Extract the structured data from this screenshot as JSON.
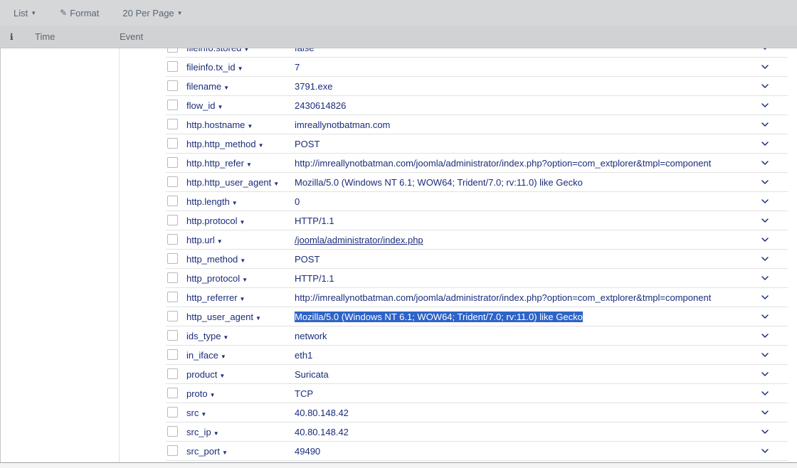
{
  "toolbar": {
    "list_label": "List",
    "format_label": "Format",
    "per_page_label": "20 Per Page"
  },
  "header": {
    "info_icon": "i",
    "time_label": "Time",
    "event_label": "Event"
  },
  "fields": [
    {
      "name": "fileinfo.stored",
      "value": "false",
      "style": "normal"
    },
    {
      "name": "fileinfo.tx_id",
      "value": "7",
      "style": "normal"
    },
    {
      "name": "filename",
      "value": "3791.exe",
      "style": "normal"
    },
    {
      "name": "flow_id",
      "value": "2430614826",
      "style": "normal"
    },
    {
      "name": "http.hostname",
      "value": "imreallynotbatman.com",
      "style": "normal"
    },
    {
      "name": "http.http_method",
      "value": "POST",
      "style": "normal"
    },
    {
      "name": "http.http_refer",
      "value": "http://imreallynotbatman.com/joomla/administrator/index.php?option=com_extplorer&tmpl=component",
      "style": "normal"
    },
    {
      "name": "http.http_user_agent",
      "value": "Mozilla/5.0 (Windows NT 6.1; WOW64; Trident/7.0; rv:11.0) like Gecko",
      "style": "normal"
    },
    {
      "name": "http.length",
      "value": "0",
      "style": "normal"
    },
    {
      "name": "http.protocol",
      "value": "HTTP/1.1",
      "style": "normal"
    },
    {
      "name": "http.url",
      "value": "/joomla/administrator/index.php",
      "style": "link"
    },
    {
      "name": "http_method",
      "value": "POST",
      "style": "normal"
    },
    {
      "name": "http_protocol",
      "value": "HTTP/1.1",
      "style": "normal"
    },
    {
      "name": "http_referrer",
      "value": "http://imreallynotbatman.com/joomla/administrator/index.php?option=com_extplorer&tmpl=component",
      "style": "normal"
    },
    {
      "name": "http_user_agent",
      "value": "Mozilla/5.0 (Windows NT 6.1; WOW64; Trident/7.0; rv:11.0) like Gecko",
      "style": "selected"
    },
    {
      "name": "ids_type",
      "value": "network",
      "style": "normal"
    },
    {
      "name": "in_iface",
      "value": "eth1",
      "style": "normal"
    },
    {
      "name": "product",
      "value": "Suricata",
      "style": "normal"
    },
    {
      "name": "proto",
      "value": "TCP",
      "style": "normal"
    },
    {
      "name": "src",
      "value": "40.80.148.42",
      "style": "normal"
    },
    {
      "name": "src_ip",
      "value": "40.80.148.42",
      "style": "normal"
    },
    {
      "name": "src_port",
      "value": "49490",
      "style": "normal"
    }
  ],
  "icons": {
    "field_dropdown": "caret-down-icon",
    "row_expand": "chevron-down-icon",
    "format": "pencil-icon",
    "info": "info-icon"
  },
  "colors": {
    "field_text": "#1a2c7a",
    "selection": "#2e63c7",
    "toolbar_bg": "#d5d7d9"
  }
}
